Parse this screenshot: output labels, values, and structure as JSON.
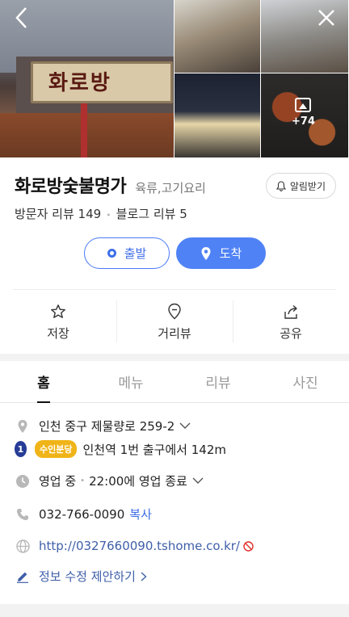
{
  "gallery": {
    "main_sign_text": "화로방",
    "more_count": "+74"
  },
  "place": {
    "name": "화로방숯불명가",
    "category": "육류,고기요리",
    "alarm_label": "알림받기",
    "visitor_reviews": "방문자 리뷰 149",
    "blog_reviews": "블로그 리뷰 5"
  },
  "route": {
    "start_label": "출발",
    "arrive_label": "도착"
  },
  "actions": [
    {
      "label": "저장",
      "icon": "star-icon"
    },
    {
      "label": "거리뷰",
      "icon": "map-pin-icon"
    },
    {
      "label": "공유",
      "icon": "share-icon"
    }
  ],
  "tabs": [
    {
      "label": "홈",
      "active": true
    },
    {
      "label": "메뉴",
      "active": false
    },
    {
      "label": "리뷰",
      "active": false
    },
    {
      "label": "사진",
      "active": false
    }
  ],
  "info": {
    "address": "인천 중구 제물량로 259-2",
    "subway_line": "1",
    "subway_badge": "수인분당",
    "subway_text": "인천역 1번 출구에서 142m",
    "hours_status": "영업 중",
    "hours_detail": "22:00에 영업 종료",
    "phone": "032-766-0090",
    "copy_label": "복사",
    "website": "http://0327660090.tshome.co.kr/",
    "suggest_edit": "정보 수정 제안하기"
  },
  "colors": {
    "accent": "#4f82f5",
    "subway_line_1": "#263c96",
    "suin_bundang": "#f0b418"
  }
}
